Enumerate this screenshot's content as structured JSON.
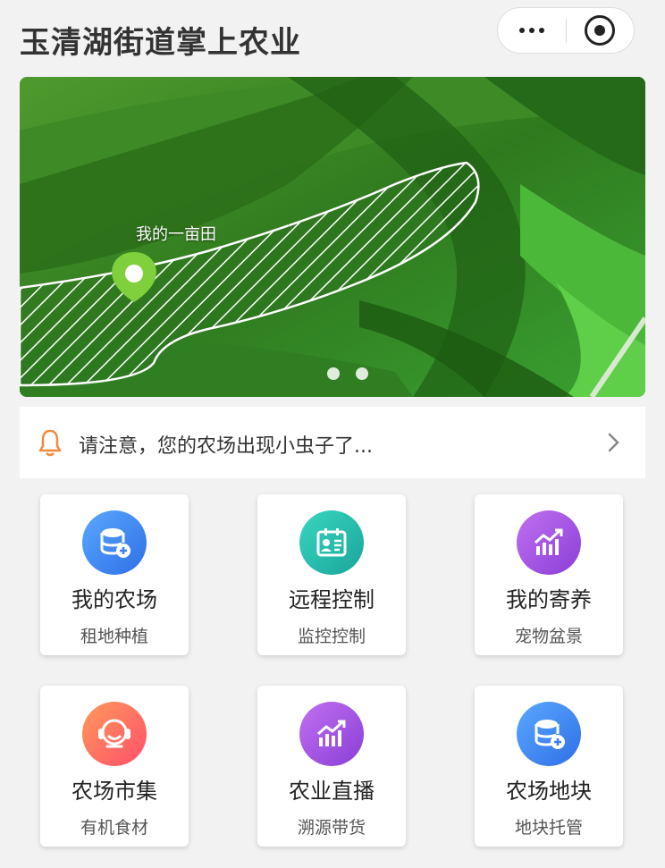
{
  "header": {
    "title": "玉清湖街道掌上农业",
    "more_icon": "more-dots-icon",
    "close_icon": "target-circle-icon"
  },
  "banner": {
    "pin_label": "我的一亩田",
    "slides": 2,
    "active_slide": 1
  },
  "notice": {
    "text": "请注意，您的农场出现小虫子了..."
  },
  "menu": [
    {
      "title": "我的农场",
      "subtitle": "租地种植",
      "icon": "database-icon",
      "color": "blue"
    },
    {
      "title": "远程控制",
      "subtitle": "监控控制",
      "icon": "id-card-icon",
      "color": "teal"
    },
    {
      "title": "我的寄养",
      "subtitle": "宠物盆景",
      "icon": "chart-up-icon",
      "color": "purple"
    },
    {
      "title": "农场市集",
      "subtitle": "有机食材",
      "icon": "smiley-icon",
      "color": "orange"
    },
    {
      "title": "农业直播",
      "subtitle": "溯源带货",
      "icon": "chart-up-icon",
      "color": "purple"
    },
    {
      "title": "农场地块",
      "subtitle": "地块托管",
      "icon": "database-icon",
      "color": "blue"
    }
  ],
  "colors": {
    "accent_bell": "#f08a3c",
    "text": "#333333",
    "background": "#f2f2f2"
  }
}
